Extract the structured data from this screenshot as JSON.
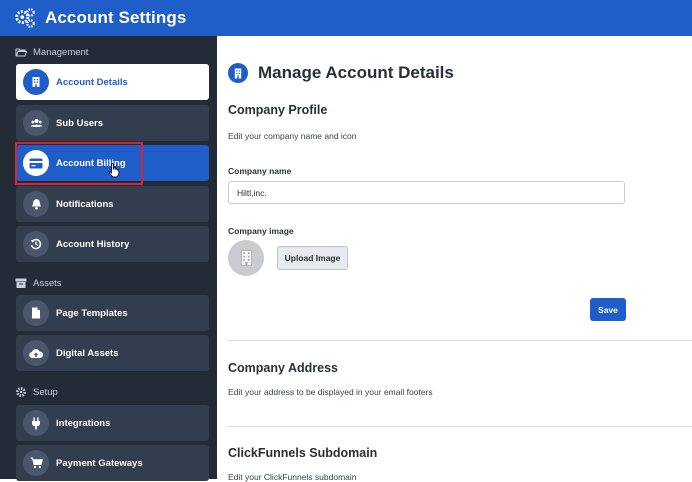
{
  "header": {
    "title": "Account Settings",
    "icon": "gears-icon"
  },
  "sidebar": {
    "sections": [
      {
        "label": "Management",
        "icon": "folder-open-icon"
      },
      {
        "label": "Assets",
        "icon": "archive-icon"
      },
      {
        "label": "Setup",
        "icon": "gear-icon"
      }
    ],
    "items": [
      {
        "label": "Account Details",
        "icon": "building-icon",
        "state": "active"
      },
      {
        "label": "Sub Users",
        "icon": "users-icon"
      },
      {
        "label": "Account Billing",
        "icon": "credit-card-icon",
        "state": "hover"
      },
      {
        "label": "Notifications",
        "icon": "bell-icon"
      },
      {
        "label": "Account History",
        "icon": "history-icon"
      },
      {
        "label": "Page Templates",
        "icon": "file-icon"
      },
      {
        "label": "Digital Assets",
        "icon": "cloud-upload-icon"
      },
      {
        "label": "Integrations",
        "icon": "plug-icon"
      },
      {
        "label": "Payment Gateways",
        "icon": "cart-icon"
      }
    ]
  },
  "main": {
    "title": "Manage Account Details",
    "company_profile": {
      "title": "Company Profile",
      "description": "Edit your company name and icon",
      "name_label": "Company name",
      "name_value": "Hiltl,inc.",
      "image_label": "Company image",
      "upload_label": "Upload Image",
      "save_label": "Save"
    },
    "company_address": {
      "title": "Company Address",
      "description": "Edit your address to be displayed in your email footers"
    },
    "subdomain": {
      "title": "ClickFunnels Subdomain",
      "description": "Edit your ClickFunnels subdomain"
    }
  },
  "colors": {
    "brand": "#1f5ec8",
    "sidebar": "#232b36",
    "sidebar_item": "#323e4e",
    "highlight": "#e0202a"
  }
}
